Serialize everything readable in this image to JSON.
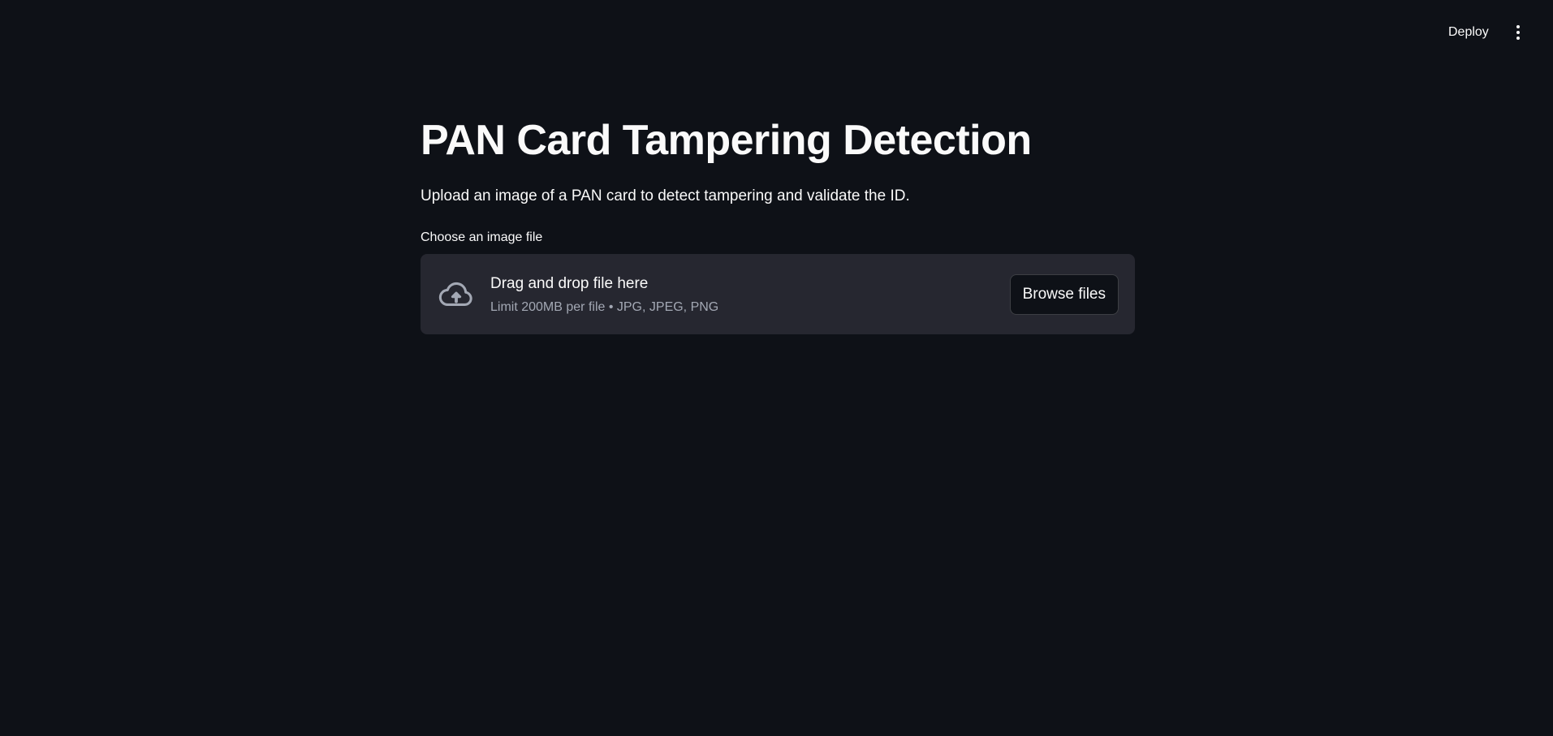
{
  "header": {
    "deploy_label": "Deploy",
    "menu_icon": "more-vertical-icon"
  },
  "main": {
    "title": "PAN Card Tampering Detection",
    "subtitle": "Upload an image of a PAN card to detect tampering and validate the ID."
  },
  "uploader": {
    "label": "Choose an image file",
    "icon": "cloud-upload-icon",
    "instructions": "Drag and drop file here",
    "limit_text": "Limit 200MB per file • JPG, JPEG, PNG",
    "browse_label": "Browse files"
  },
  "colors": {
    "background": "#0e1117",
    "dropzone_background": "#262730",
    "text": "#fafafa",
    "muted_text": "#a3a8b4"
  }
}
